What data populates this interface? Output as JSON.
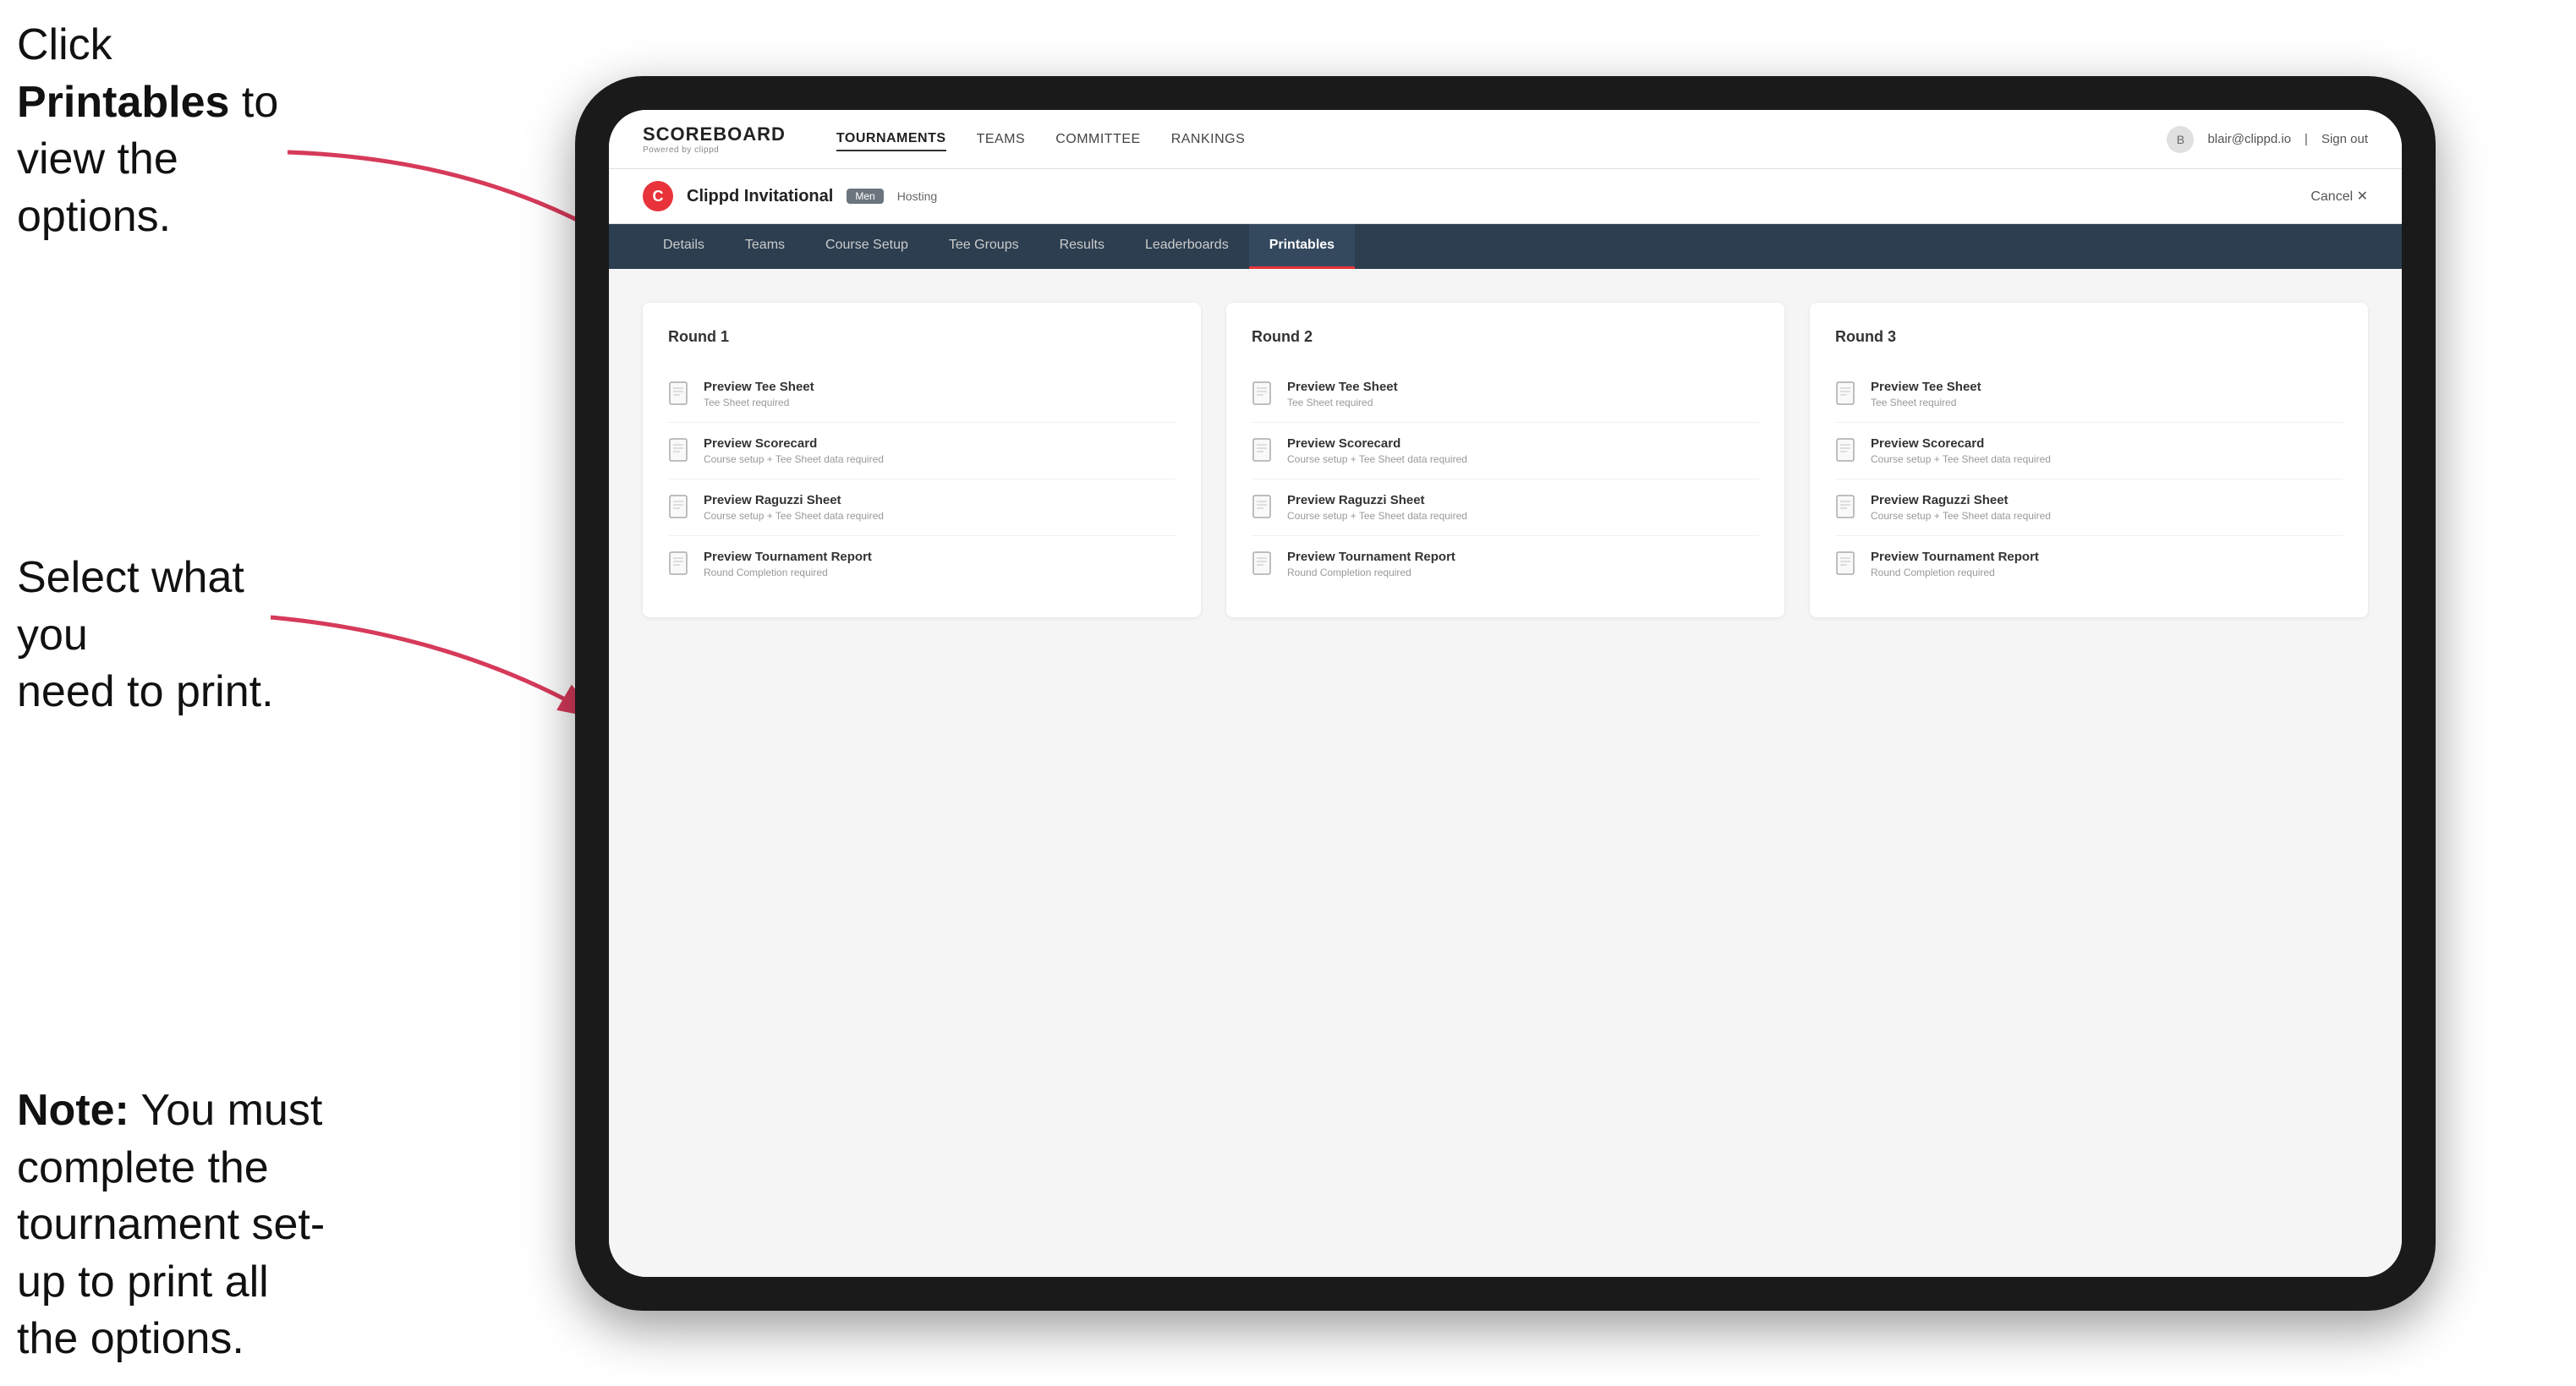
{
  "instructions": {
    "top": "Click ",
    "top_bold": "Printables",
    "top_rest": " to view the options.",
    "middle_line1": "Select what you",
    "middle_line2": "need to print.",
    "bottom_bold": "Note:",
    "bottom_rest": " You must complete the tournament set-up to print all the options."
  },
  "header": {
    "logo_title": "SCOREBOARD",
    "logo_sub": "Powered by clippd",
    "nav": [
      "TOURNAMENTS",
      "TEAMS",
      "COMMITTEE",
      "RANKINGS"
    ],
    "user_email": "blair@clippd.io",
    "sign_out": "Sign out"
  },
  "tournament": {
    "logo_letter": "C",
    "name": "Clippd Invitational",
    "gender": "Men",
    "status": "Hosting",
    "cancel": "Cancel ✕"
  },
  "tabs": [
    "Details",
    "Teams",
    "Course Setup",
    "Tee Groups",
    "Results",
    "Leaderboards",
    "Printables"
  ],
  "active_tab": "Printables",
  "rounds": [
    {
      "title": "Round 1",
      "items": [
        {
          "title": "Preview Tee Sheet",
          "subtitle": "Tee Sheet required"
        },
        {
          "title": "Preview Scorecard",
          "subtitle": "Course setup + Tee Sheet data required"
        },
        {
          "title": "Preview Raguzzi Sheet",
          "subtitle": "Course setup + Tee Sheet data required"
        },
        {
          "title": "Preview Tournament Report",
          "subtitle": "Round Completion required"
        }
      ]
    },
    {
      "title": "Round 2",
      "items": [
        {
          "title": "Preview Tee Sheet",
          "subtitle": "Tee Sheet required"
        },
        {
          "title": "Preview Scorecard",
          "subtitle": "Course setup + Tee Sheet data required"
        },
        {
          "title": "Preview Raguzzi Sheet",
          "subtitle": "Course setup + Tee Sheet data required"
        },
        {
          "title": "Preview Tournament Report",
          "subtitle": "Round Completion required"
        }
      ]
    },
    {
      "title": "Round 3",
      "items": [
        {
          "title": "Preview Tee Sheet",
          "subtitle": "Tee Sheet required"
        },
        {
          "title": "Preview Scorecard",
          "subtitle": "Course setup + Tee Sheet data required"
        },
        {
          "title": "Preview Raguzzi Sheet",
          "subtitle": "Course setup + Tee Sheet data required"
        },
        {
          "title": "Preview Tournament Report",
          "subtitle": "Round Completion required"
        }
      ]
    }
  ],
  "colors": {
    "accent": "#e8333a",
    "nav_bg": "#2c3e50",
    "active_tab_bg": "#34495e"
  }
}
